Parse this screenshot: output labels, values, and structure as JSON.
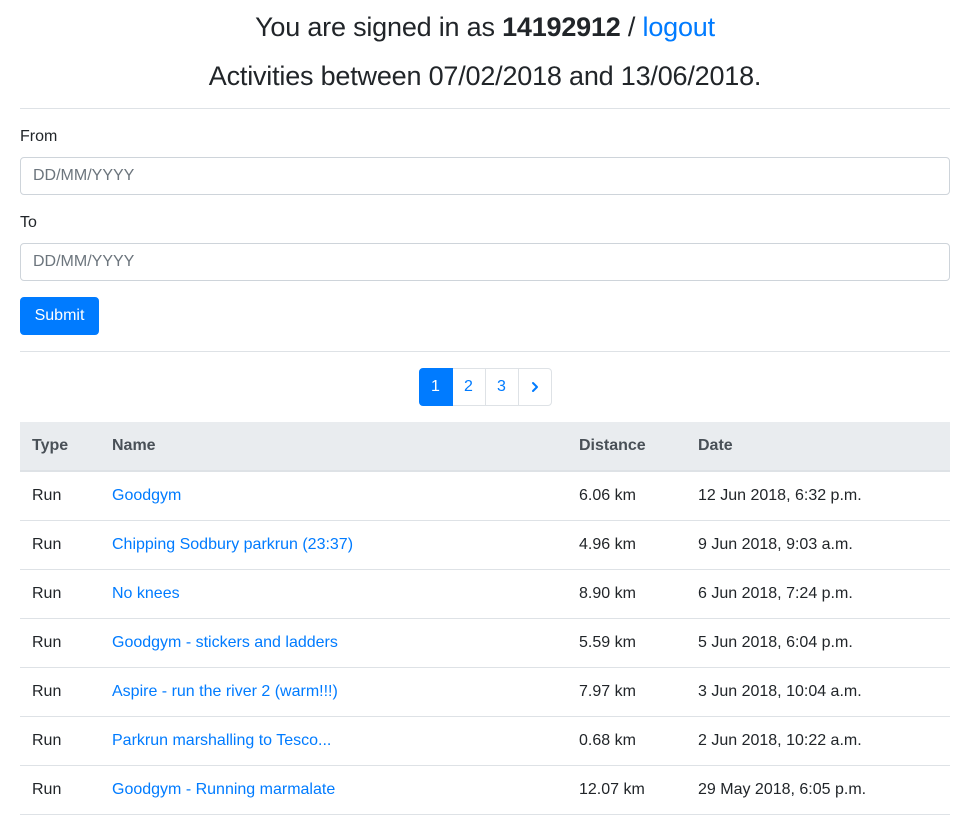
{
  "header": {
    "signed_in_prefix": "You are signed in as ",
    "username": "14192912",
    "separator": " / ",
    "logout_label": "logout",
    "activities_title": "Activities between 07/02/2018 and 13/06/2018."
  },
  "form": {
    "from_label": "From",
    "from_placeholder": "DD/MM/YYYY",
    "to_label": "To",
    "to_placeholder": "DD/MM/YYYY",
    "submit_label": "Submit"
  },
  "pagination": {
    "pages": [
      "1",
      "2",
      "3"
    ],
    "active_page": "1",
    "next_icon": "chevron-right-icon"
  },
  "table": {
    "columns": [
      "Type",
      "Name",
      "Distance",
      "Date"
    ],
    "rows": [
      {
        "type": "Run",
        "name": "Goodgym",
        "distance": "6.06 km",
        "date": "12 Jun 2018, 6:32 p.m."
      },
      {
        "type": "Run",
        "name": "Chipping Sodbury parkrun (23:37)",
        "distance": "4.96 km",
        "date": "9 Jun 2018, 9:03 a.m."
      },
      {
        "type": "Run",
        "name": "No knees",
        "distance": "8.90 km",
        "date": "6 Jun 2018, 7:24 p.m."
      },
      {
        "type": "Run",
        "name": "Goodgym - stickers and ladders",
        "distance": "5.59 km",
        "date": "5 Jun 2018, 6:04 p.m."
      },
      {
        "type": "Run",
        "name": "Aspire - run the river 2 (warm!!!)",
        "distance": "7.97 km",
        "date": "3 Jun 2018, 10:04 a.m."
      },
      {
        "type": "Run",
        "name": "Parkrun marshalling to Tesco...",
        "distance": "0.68 km",
        "date": "2 Jun 2018, 10:22 a.m."
      },
      {
        "type": "Run",
        "name": "Goodgym - Running marmalate",
        "distance": "12.07 km",
        "date": "29 May 2018, 6:05 p.m."
      }
    ]
  },
  "colors": {
    "primary": "#007bff",
    "table_header_bg": "#e9ecef",
    "border": "#dee2e6",
    "text": "#212529"
  }
}
